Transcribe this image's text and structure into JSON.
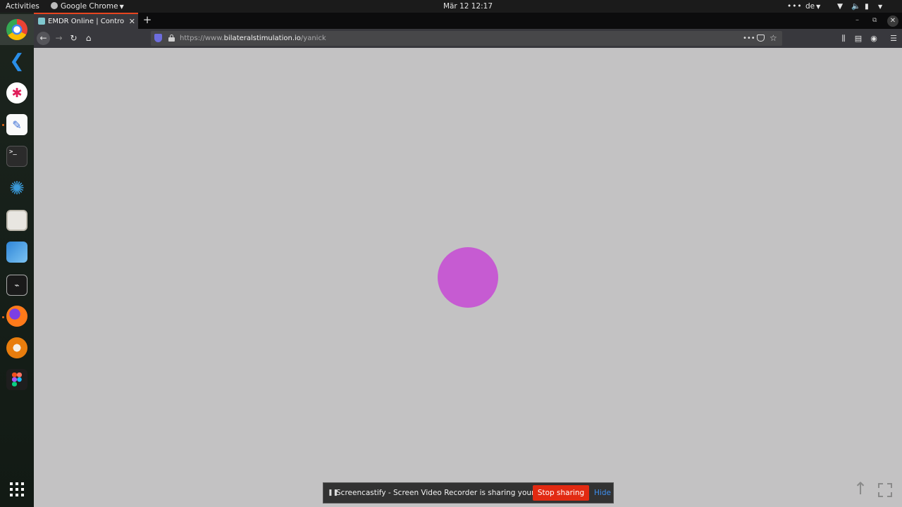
{
  "topbar": {
    "activities": "Activities",
    "app_name": "Google Chrome",
    "clock": "Mär 12  12:17",
    "keyboard_layout": "de"
  },
  "dock": {
    "icons": [
      "chrome-icon",
      "vscode-icon",
      "slack-icon",
      "text-editor-icon",
      "terminal-icon",
      "steam-icon",
      "files-icon",
      "software-center-icon",
      "system-monitor-icon",
      "firefox-icon",
      "blender-icon",
      "figma-icon",
      "app-grid-icon"
    ]
  },
  "browser": {
    "tab_title": "EMDR Online | Controlla",
    "url_prefix": "https://www.",
    "url_host": "bilateralstimulation.io",
    "url_path": "/yanick",
    "page_actions": "•••"
  },
  "content": {
    "ball_color": "#c65bd2",
    "background_color": "#c3c2c3"
  },
  "share_bar": {
    "message": "Screencastify - Screen Video Recorder is sharing your screen.",
    "stop_label": "Stop sharing",
    "hide_label": "Hide"
  },
  "colors": {
    "tab_accent": "#e8451f",
    "stop_button": "#e22a12",
    "hide_link": "#3e8ff0"
  }
}
